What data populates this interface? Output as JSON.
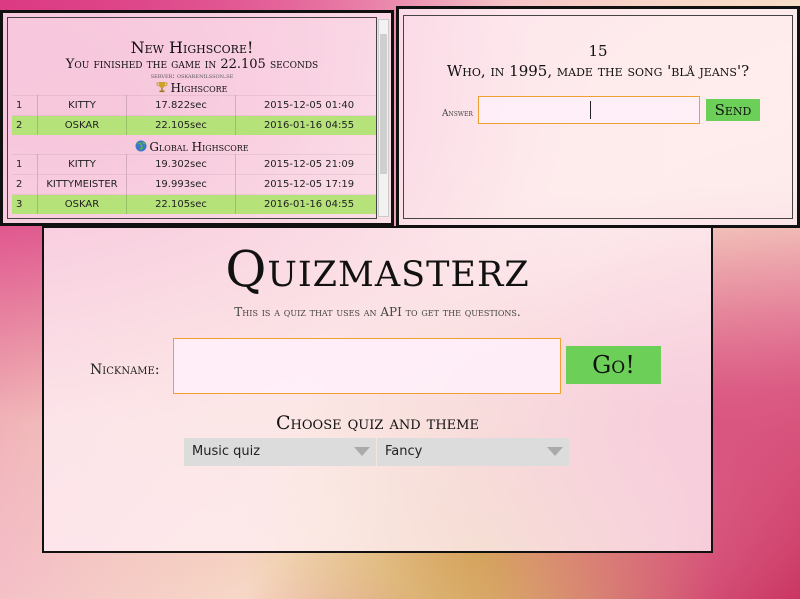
{
  "highscore": {
    "title": "New Highscore!",
    "subtitle": "You finished the game in 22.105 seconds",
    "server": "server: oskarenilsson.se",
    "local_heading": "Highscore",
    "local_rows": [
      {
        "rank": "1",
        "name": "Kitty",
        "time": "17.822sec",
        "date": "2015-12-05 01:40",
        "highlight": false
      },
      {
        "rank": "2",
        "name": "Oskar",
        "time": "22.105sec",
        "date": "2016-01-16 04:55",
        "highlight": true
      }
    ],
    "global_heading": "Global Highscore",
    "global_rows": [
      {
        "rank": "1",
        "name": "Kitty",
        "time": "19.302sec",
        "date": "2015-12-05 21:09",
        "highlight": false
      },
      {
        "rank": "2",
        "name": "Kittymeister",
        "time": "19.993sec",
        "date": "2015-12-05 17:19",
        "highlight": false
      },
      {
        "rank": "3",
        "name": "Oskar",
        "time": "22.105sec",
        "date": "2016-01-16 04:55",
        "highlight": true
      }
    ],
    "icons": {
      "local": "trophy-icon",
      "global": "globe-icon"
    }
  },
  "question": {
    "number": "15",
    "text": "Who, in 1995, made the song 'blå jeans'?",
    "answer_label": "Answer",
    "answer_value": "",
    "send_label": "Send"
  },
  "main": {
    "title": "Quizmasterz",
    "subtitle": "This is a quiz that uses an API to get the questions.",
    "nickname_label": "Nickname:",
    "nickname_value": "",
    "go_label": "Go!",
    "choose_heading": "Choose quiz and theme",
    "quiz_select": "Music quiz",
    "theme_select": "Fancy"
  },
  "colors": {
    "accent_green": "#6ccf58",
    "highlight_row": "#b6e27a",
    "input_border": "#f0a030"
  }
}
